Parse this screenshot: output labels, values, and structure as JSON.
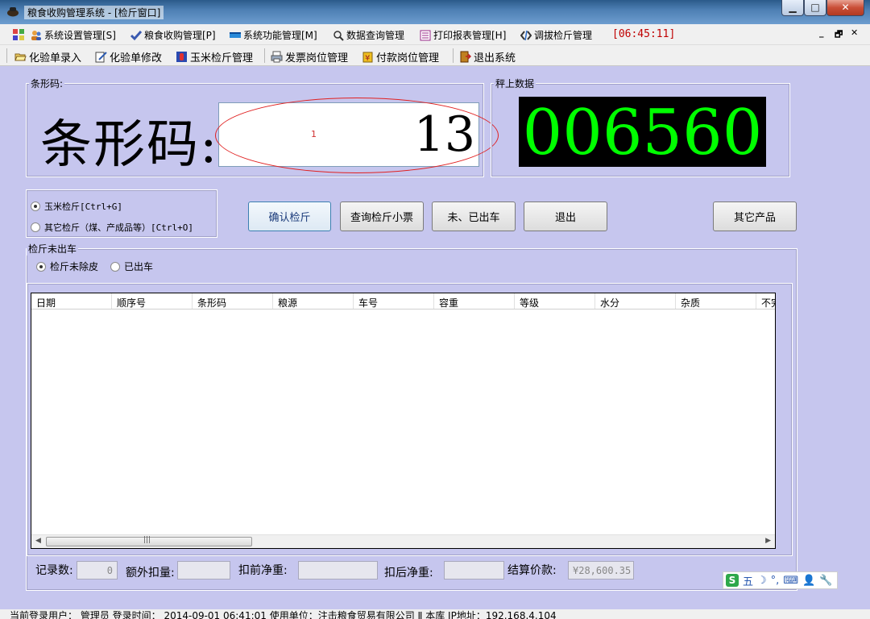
{
  "window": {
    "title": "粮食收购管理系统 - [检斤窗口]",
    "min_glyph": "▁",
    "max_glyph": "□",
    "close_glyph": "✕"
  },
  "menu": {
    "items": [
      {
        "label": "系统设置管理[S]",
        "icon": "users-icon"
      },
      {
        "label": "粮食收购管理[P]",
        "icon": "checkmark-icon"
      },
      {
        "label": "系统功能管理[M]",
        "icon": "panel-icon"
      },
      {
        "label": "数据查询管理",
        "icon": "search-icon"
      },
      {
        "label": "打印报表管理[H]",
        "icon": "report-icon"
      },
      {
        "label": "调拔检斤管理",
        "icon": "transfer-icon"
      }
    ],
    "clock": "[06:45:11]",
    "mdi_min": "_",
    "mdi_restore": "🗗",
    "mdi_close": "✕"
  },
  "toolbar": {
    "items": [
      {
        "label": "化验单录入",
        "icon": "folder-open-icon"
      },
      {
        "label": "化验单修改",
        "icon": "edit-icon"
      },
      {
        "label": "玉米检斤管理",
        "icon": "corn-icon"
      },
      {
        "label": "发票岗位管理",
        "icon": "printer-icon"
      },
      {
        "label": "付款岗位管理",
        "icon": "payment-icon"
      },
      {
        "label": "退出系统",
        "icon": "exit-icon"
      }
    ]
  },
  "barcode": {
    "group_label": "条形码:",
    "big_label": "条形码:",
    "value": "13",
    "mark": "1"
  },
  "scale": {
    "group_label": "秤上数据",
    "value": "006560",
    "color": "#00ff00"
  },
  "weigh_type": {
    "corn": "玉米检斤[Ctrl+G]",
    "other": "其它检斤（煤、产成品等）[Ctrl+O]",
    "selected": "corn"
  },
  "buttons": {
    "confirm": "确认检斤",
    "query_ticket": "查询检斤小票",
    "not_out": "未、已出车",
    "exit": "退出",
    "other_products": "其它产品"
  },
  "unshipped": {
    "group_label": "检斤未出车",
    "opt_not_tared": "检斤未除皮",
    "opt_shipped": "已出车",
    "selected": "opt_not_tared"
  },
  "grid": {
    "columns": [
      "日期",
      "顺序号",
      "条形码",
      "粮源",
      "车号",
      "容重",
      "等级",
      "水分",
      "杂质",
      "不完"
    ],
    "rows": []
  },
  "stats": {
    "record_count_label": "记录数:",
    "record_count": "0",
    "extra_deduct_label": "额外扣量:",
    "extra_deduct": "",
    "net_before_label": "扣前净重:",
    "net_before": "",
    "net_after_label": "扣后净重:",
    "net_after": "",
    "price_label": "结算价款:",
    "price": "¥28,600.35"
  },
  "ime": {
    "logo": "S",
    "mode": "五",
    "moon": "☽",
    "punct": "°,",
    "keyboard": "⌨",
    "user": "👤",
    "tool": "🔧"
  },
  "status": {
    "text": "当前登录用户：   管理员          登录时间：   2014-09-01 06:41:01         使用单位：注击粮食贸易有限公司  Ⅱ   本库   IP地址：192.168.4.104"
  }
}
